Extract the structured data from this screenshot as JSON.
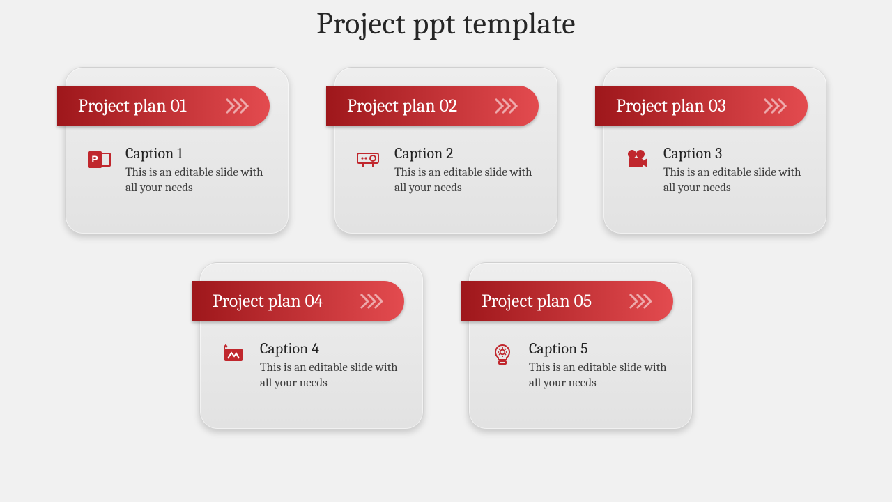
{
  "title": "Project ppt template",
  "accent": "#c0272d",
  "cards": [
    {
      "header": "Project plan 01",
      "caption": "Caption 1",
      "desc": "This is an editable slide with all your needs",
      "icon": "powerpoint"
    },
    {
      "header": "Project plan 02",
      "caption": "Caption 2",
      "desc": "This is an editable slide with all your needs",
      "icon": "projector"
    },
    {
      "header": "Project plan 03",
      "caption": "Caption 3",
      "desc": "This is an editable slide with all your needs",
      "icon": "film-camera"
    },
    {
      "header": "Project plan 04",
      "caption": "Caption 4",
      "desc": "This is an editable slide with all your needs",
      "icon": "blueprint"
    },
    {
      "header": "Project plan 05",
      "caption": "Caption 5",
      "desc": "This is an editable slide with all your needs",
      "icon": "idea-gear"
    }
  ]
}
